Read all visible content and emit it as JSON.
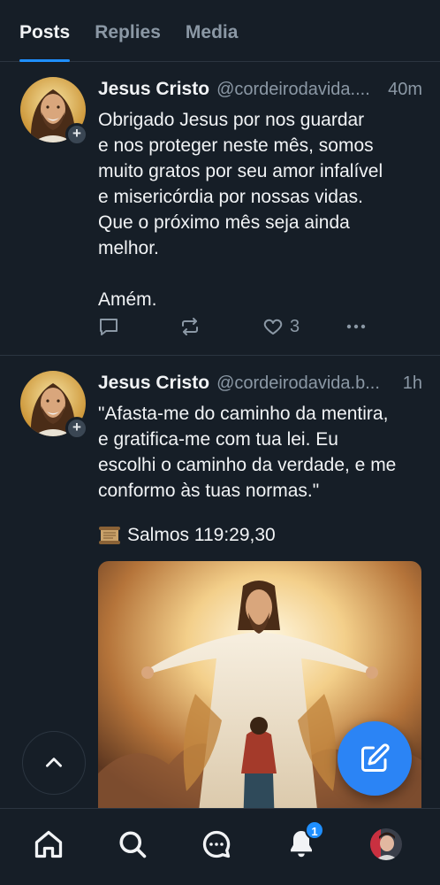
{
  "tabs": [
    {
      "label": "Posts",
      "active": true
    },
    {
      "label": "Replies",
      "active": false
    },
    {
      "label": "Media",
      "active": false
    }
  ],
  "posts": [
    {
      "author": "Jesus Cristo",
      "handle": "@cordeirodavida....",
      "time": "40m",
      "text": "Obrigado Jesus por nos guardar\ne nos proteger neste mês, somos\nmuito gratos por seu amor infalível\ne misericórdia por nossas vidas.\nQue o próximo mês seja ainda\nmelhor.\n\nAmém.",
      "like_count": "3"
    },
    {
      "author": "Jesus Cristo",
      "handle": "@cordeirodavida.b...",
      "time": "1h",
      "text": "\"Afasta-me do caminho da mentira,\ne gratifica-me com tua lei. Eu\nescolhi o caminho da verdade, e me\nconformo às tuas normas.\"",
      "reference": "Salmos 119:29,30"
    }
  ],
  "nav": {
    "notification_count": "1"
  },
  "colors": {
    "background": "#161e27",
    "accent": "#1f8fff",
    "compose": "#2b84f5",
    "muted": "#8b98a5"
  },
  "icons": [
    "reply-icon",
    "repost-icon",
    "heart-icon",
    "more-icon",
    "scroll-icon",
    "chevron-up-icon",
    "compose-icon",
    "home-icon",
    "search-icon",
    "chat-icon",
    "bell-icon"
  ]
}
